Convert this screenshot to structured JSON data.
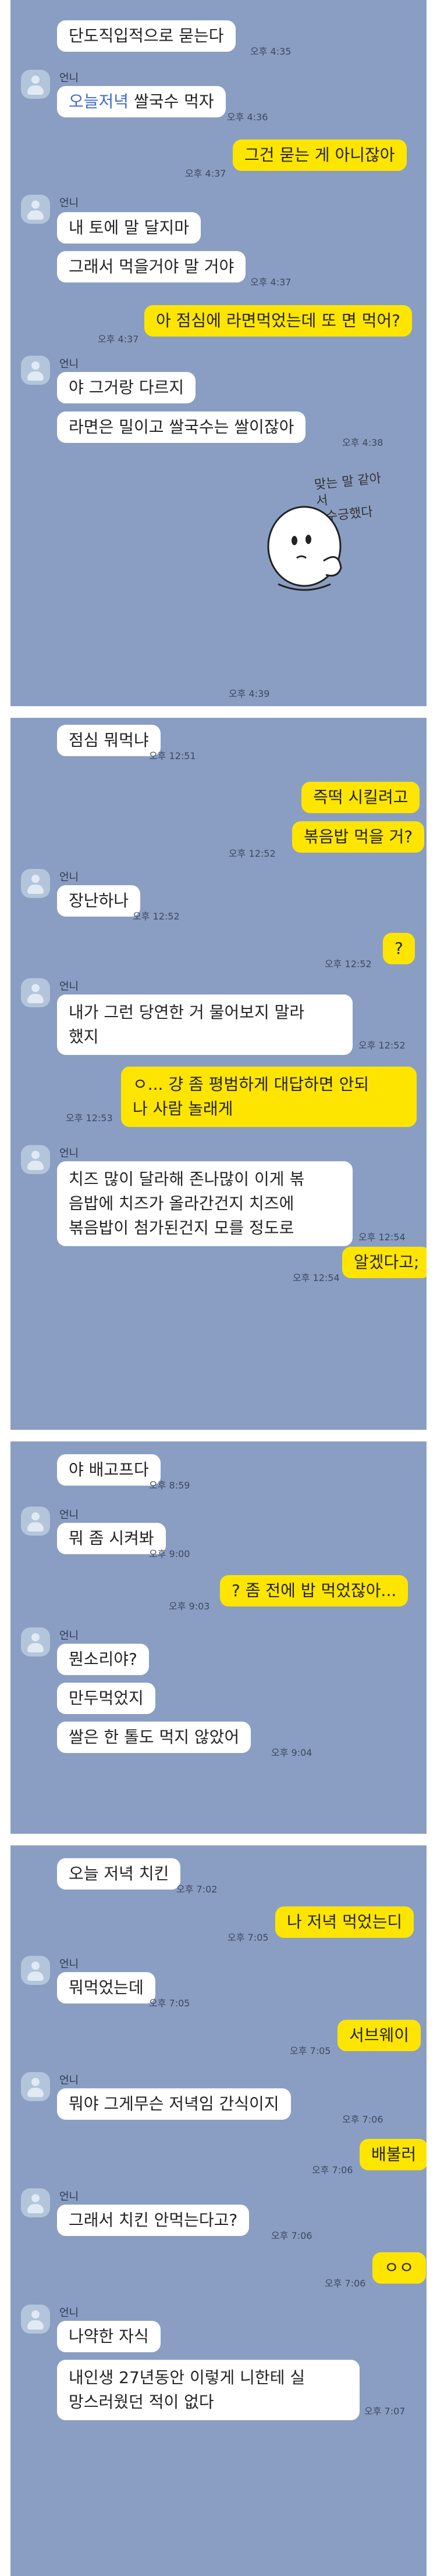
{
  "p1": {
    "m1": "단도직입적으로 묻는다",
    "t1": "오후 4:35",
    "name": "언니",
    "m2_hl": "오늘저녁",
    "m2_rest": " 쌀국수 먹자",
    "t2": "오후 4:36",
    "m3": "그건 묻는 게 아니잖아",
    "t3": "오후 4:37",
    "m4": "내 토에 말 달지마",
    "m5": "그래서 먹을거야 말 거야",
    "t5": "오후 4:37",
    "m6": "아 점심에 라면먹었는데 또 면 먹어?",
    "t6": "오후 4:37",
    "m7": "야 그거랑 다르지",
    "m8": "라면은 밀이고 쌀국수는 쌀이잖아",
    "t8": "오후 4:38",
    "sticker1": "맞는 말 같아서",
    "sticker2": "수긍했다",
    "t9": "오후 4:39"
  },
  "p2": {
    "m1": "점심 뭐먹냐",
    "t1": "오후 12:51",
    "m2": "즉떡 시킬려고",
    "m3": "볶음밥 먹을 거?",
    "t3": "오후 12:52",
    "name": "언니",
    "m4": "장난하나",
    "t4": "오후 12:52",
    "m5": "?",
    "t5": "오후 12:52",
    "m6_l1": "내가 그런 당연한 거 물어보지 말라",
    "m6_l2": "했지",
    "t6": "오후 12:52",
    "m7_l1": "ㅇ... 걍 좀 평범하게 대답하면 안되",
    "m7_l2": "나 사람 놀래게",
    "t7": "오후 12:53",
    "m8_l1": "치즈 많이 달라해 존나많이 이게 볶",
    "m8_l2": "음밥에 치즈가 올라간건지 치즈에",
    "m8_l3": "볶음밥이 첨가된건지 모를 정도로",
    "t8": "오후 12:54",
    "m9": "알겠다고;",
    "t9": "오후 12:54"
  },
  "p3": {
    "m1": "야 배고프다",
    "t1": "오후 8:59",
    "name": "언니",
    "m2": "뭐 좀 시켜봐",
    "t2": "오후 9:00",
    "m3": "? 좀 전에 밥 먹었잖아...",
    "t3": "오후 9:03",
    "m4": "뭔소리야?",
    "m5": "만두먹었지",
    "m6": "쌀은 한 톨도 먹지 않았어",
    "t6": "오후 9:04"
  },
  "p4": {
    "m1": "오늘 저녁 치킨",
    "t1": "오후 7:02",
    "m2": "나 저녁 먹었는디",
    "t2": "오후 7:05",
    "name": "언니",
    "m3": "뭐먹었는데",
    "t3": "오후 7:05",
    "m4": "서브웨이",
    "t4": "오후 7:05",
    "m5": "뭐야 그게무슨 저녁임 간식이지",
    "t5": "오후 7:06",
    "m6": "배불러",
    "t6": "오후 7:06",
    "m7": "그래서 치킨 안먹는다고?",
    "t7": "오후 7:06",
    "m8": "ㅇㅇ",
    "t8": "오후 7:06",
    "m9": "나약한 자식",
    "m10_l1": "내인생 27년동안 이렇게 니한테 실",
    "m10_l2": "망스러웠던 적이 없다",
    "t10": "오후 7:07"
  }
}
